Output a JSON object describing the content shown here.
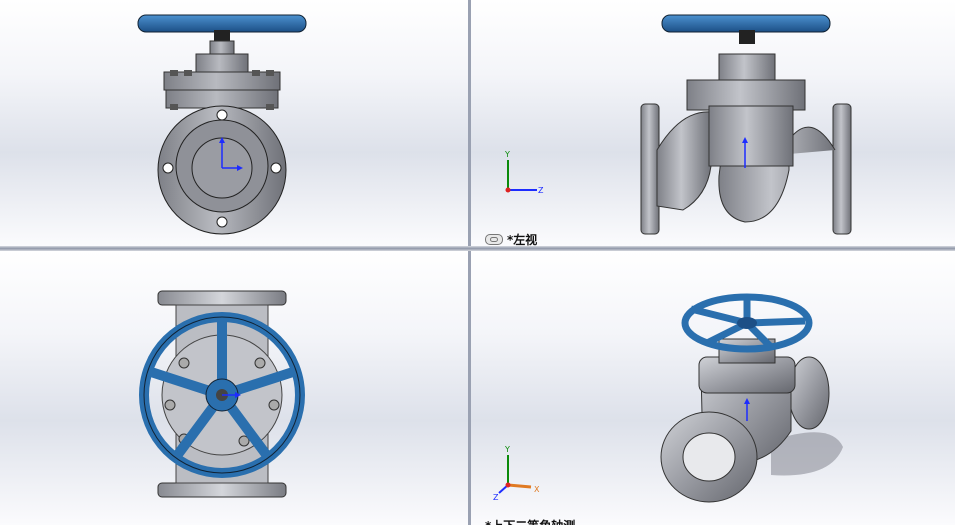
{
  "viewports": {
    "front": {
      "name": "front"
    },
    "left": {
      "label": "*左视",
      "triad": {
        "y": "Y",
        "z": "Z"
      }
    },
    "top": {
      "name": "top"
    },
    "iso": {
      "label": "*上下二等角轴测",
      "triad": {
        "y": "Y",
        "z": "Z",
        "x": "X"
      }
    }
  },
  "colors": {
    "handwheel": "#2a6fae",
    "body": "#9a9ca3",
    "background_top": "#ffffff",
    "background_mid": "#dde1ea"
  },
  "icons": [
    "link-icon",
    "triad-icon",
    "origin-arrow-icon"
  ]
}
